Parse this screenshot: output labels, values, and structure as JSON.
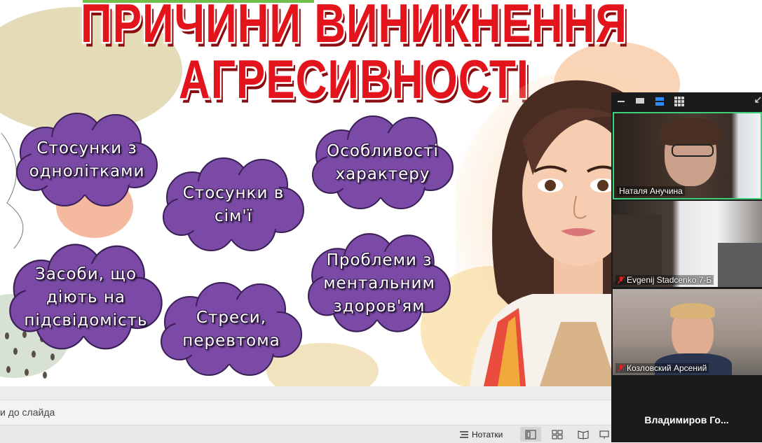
{
  "slide": {
    "title_line1": "ПРИЧИНИ ВИНИКНЕННЯ",
    "title_line2": "АГРЕСИВНОСТІ",
    "clouds": [
      "Стосунки з\nоднолітками",
      "Стосунки в\nсім'ї",
      "Особливості\nхарактеру",
      "Засоби, що\nдіють на\nпідсвідомість",
      "Стреси,\nперевтома",
      "Проблеми з\nментальним\nздоров'ям"
    ]
  },
  "notes": {
    "hint": "и до слайда"
  },
  "status_bar": {
    "notes_label": "Нотатки"
  },
  "zoom": {
    "toolbar_icons": [
      "minimize-icon",
      "speaker-view-icon",
      "film-strip-icon",
      "gallery-view-icon",
      "exit-fullscreen-icon"
    ],
    "participants": [
      {
        "name": "Наталя Анучина",
        "muted": false,
        "active": true
      },
      {
        "name": "Evgenij Stadcenko 7-Б",
        "muted": true,
        "active": false
      },
      {
        "name": "Козловский Арсений",
        "muted": true,
        "active": false
      }
    ],
    "overflow_name": "Владимиров  Го..."
  },
  "colors": {
    "title_red": "#e3141c",
    "cloud_purple": "#7a4aa6",
    "active_speaker": "#3fd17a",
    "muted_red": "#e02020"
  }
}
